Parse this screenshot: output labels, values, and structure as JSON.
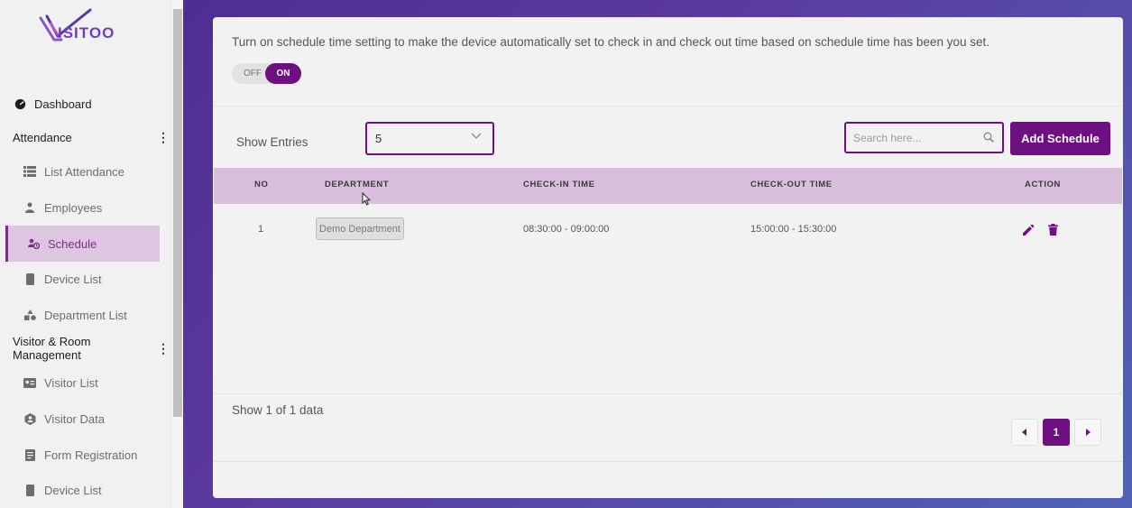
{
  "sidebar": {
    "logo_text": "ISITOO",
    "dashboard": "Dashboard",
    "sections": [
      {
        "title": "Attendance",
        "items": [
          "List Attendance",
          "Employees",
          "Schedule",
          "Device List",
          "Department List"
        ]
      },
      {
        "title": "Visitor & Room Management",
        "items": [
          "Visitor List",
          "Visitor Data",
          "Form Registration",
          "Device List"
        ]
      }
    ],
    "active_item": "Schedule"
  },
  "settings": {
    "notice": "Turn on schedule time setting to make the device automatically set to check in and check out time based on schedule time has been you set.",
    "toggle_off": "OFF",
    "toggle_on": "ON",
    "toggle_state": "ON"
  },
  "controls": {
    "show_entries_label": "Show Entries",
    "entries_value": "5",
    "search_placeholder": "Search here...",
    "add_button": "Add Schedule"
  },
  "table": {
    "columns": [
      "NO",
      "DEPARTMENT",
      "CHECK-IN TIME",
      "CHECK-OUT TIME",
      "ACTION"
    ],
    "rows": [
      {
        "no": "1",
        "department": "Demo Department",
        "check_in": "08:30:00 - 09:00:00",
        "check_out": "15:00:00 - 15:30:00"
      }
    ]
  },
  "footer": {
    "show_info": "Show 1 of 1 data",
    "current_page": "1"
  },
  "colors": {
    "primary": "#6e0f82",
    "header_bg": "#d9bfdd",
    "active_nav_bg": "#dcc6e0"
  }
}
